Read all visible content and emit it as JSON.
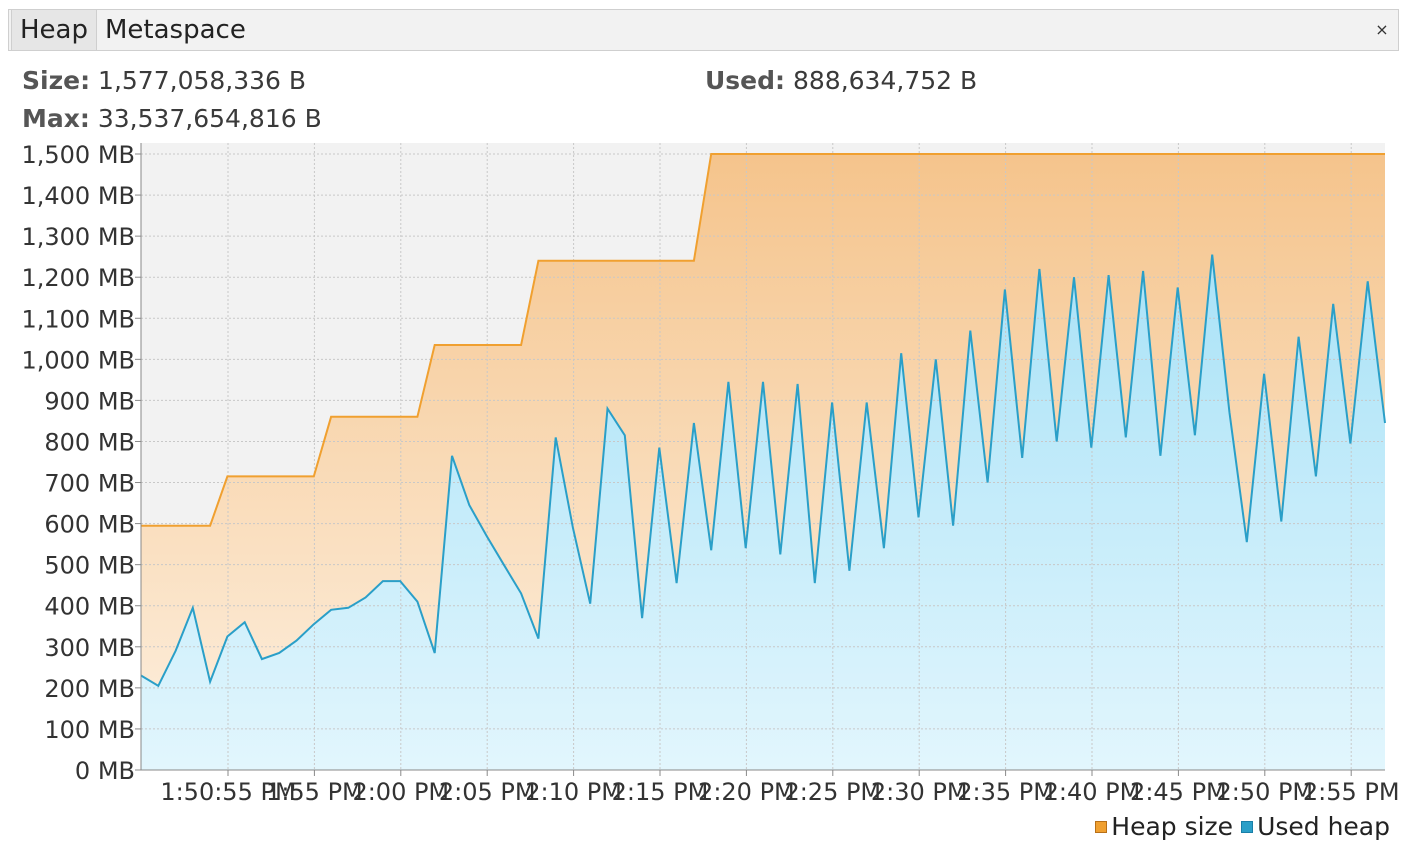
{
  "tabs": [
    {
      "label": "Heap",
      "active": true
    },
    {
      "label": "Metaspace",
      "active": false
    }
  ],
  "close_icon": "×",
  "stats": {
    "size_label": "Size:",
    "size_value": "1,577,058,336 B",
    "used_label": "Used:",
    "used_value": "888,634,752 B",
    "max_label": "Max:",
    "max_value": "33,537,654,816 B"
  },
  "colors": {
    "heap_size_line": "#f0a030",
    "used_heap_line": "#2a9fc8",
    "plot_bg": "#f2f2f2"
  },
  "chart_data": {
    "type": "area",
    "ylim": [
      0,
      1500
    ],
    "y_ticks": [
      0,
      100,
      200,
      300,
      400,
      500,
      600,
      700,
      800,
      900,
      1000,
      1100,
      1200,
      1300,
      1400,
      1500
    ],
    "y_tick_labels": [
      "0 MB",
      "100 MB",
      "200 MB",
      "300 MB",
      "400 MB",
      "500 MB",
      "600 MB",
      "700 MB",
      "800 MB",
      "900 MB",
      "1,000 MB",
      "1,100 MB",
      "1,200 MB",
      "1,300 MB",
      "1,400 MB",
      "1,500 MB"
    ],
    "x_tick_labels": [
      "1:50:55 PM",
      "1:55 PM",
      "2:00 PM",
      "2:05 PM",
      "2:10 PM",
      "2:15 PM",
      "2:20 PM",
      "2:25 PM",
      "2:30 PM",
      "2:35 PM",
      "2:40 PM",
      "2:45 PM",
      "2:50 PM",
      "2:55 PM",
      "2:00 PM",
      "2:00 PM"
    ],
    "x_count": 73,
    "legend": [
      "Heap size",
      "Used heap"
    ],
    "series": [
      {
        "name": "Heap size",
        "steps": [
          [
            0,
            595
          ],
          [
            4,
            595
          ],
          [
            5,
            715
          ],
          [
            10,
            715
          ],
          [
            11,
            860
          ],
          [
            16,
            860
          ],
          [
            17,
            1035
          ],
          [
            22,
            1035
          ],
          [
            23,
            1240
          ],
          [
            32,
            1240
          ],
          [
            33,
            1500
          ],
          [
            72,
            1500
          ]
        ]
      },
      {
        "name": "Used heap",
        "values": [
          230,
          205,
          290,
          395,
          215,
          325,
          360,
          270,
          285,
          315,
          355,
          390,
          395,
          420,
          460,
          460,
          410,
          285,
          765,
          645,
          570,
          500,
          430,
          320,
          810,
          590,
          405,
          880,
          815,
          370,
          785,
          455,
          845,
          535,
          945,
          540,
          945,
          525,
          940,
          455,
          895,
          485,
          895,
          540,
          1015,
          615,
          1000,
          595,
          1070,
          700,
          1170,
          760,
          1220,
          800,
          1200,
          785,
          1205,
          810,
          1215,
          765,
          1175,
          815,
          1255,
          870,
          555,
          965,
          605,
          1055,
          715,
          1135,
          795,
          1190,
          845
        ]
      }
    ]
  }
}
